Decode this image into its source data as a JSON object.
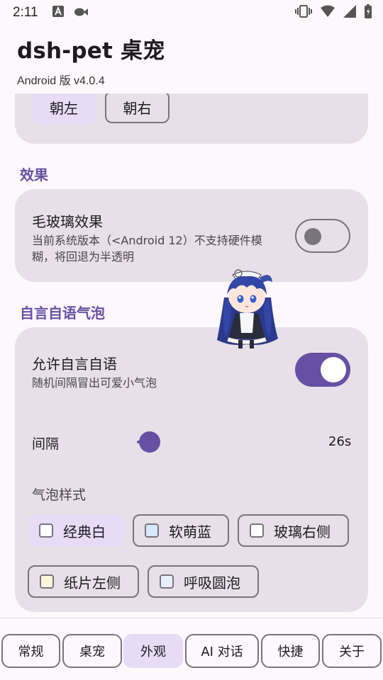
{
  "status_bar": {
    "time": "2:11"
  },
  "header": {
    "title": "dsh-pet 桌宠",
    "version": "Android 版 v4.0.4"
  },
  "direction": {
    "options": [
      {
        "label": "朝左",
        "selected": true
      },
      {
        "label": "朝右",
        "selected": false
      }
    ]
  },
  "effects": {
    "section_title": "效果",
    "frosted_glass": {
      "title": "毛玻璃效果",
      "desc_line1": "当前系统版本（<Android 12）不支持硬件模",
      "desc_line2": "糊，将回退为半透明",
      "enabled": false
    }
  },
  "bubbles": {
    "section_title": "自言自语气泡",
    "allow": {
      "title": "允许自言自语",
      "desc": "随机间隔冒出可爱小气泡",
      "enabled": true
    },
    "interval": {
      "label": "间隔",
      "value_text": "26s",
      "fraction": 0.02
    },
    "style": {
      "label": "气泡样式",
      "options": [
        {
          "label": "经典白",
          "selected": true,
          "color": "#ffffff"
        },
        {
          "label": "软萌蓝",
          "selected": false,
          "color": "#d6e8fb"
        },
        {
          "label": "玻璃右侧",
          "selected": false,
          "color": "#ffffff"
        },
        {
          "label": "纸片左侧",
          "selected": false,
          "color": "#fdf6dc"
        },
        {
          "label": "呼吸圆泡",
          "selected": false,
          "color": "#e6f0fa"
        }
      ]
    }
  },
  "tabs": [
    {
      "label": "常规",
      "active": false
    },
    {
      "label": "桌宠",
      "active": false
    },
    {
      "label": "外观",
      "active": true
    },
    {
      "label": "AI 对话",
      "active": false
    },
    {
      "label": "快捷",
      "active": false
    },
    {
      "label": "关于",
      "active": false
    }
  ],
  "colors": {
    "accent": "#6750a4",
    "card": "#e8e0e8",
    "background": "#fdf8fc",
    "selected_chip": "#e6dcf5"
  }
}
